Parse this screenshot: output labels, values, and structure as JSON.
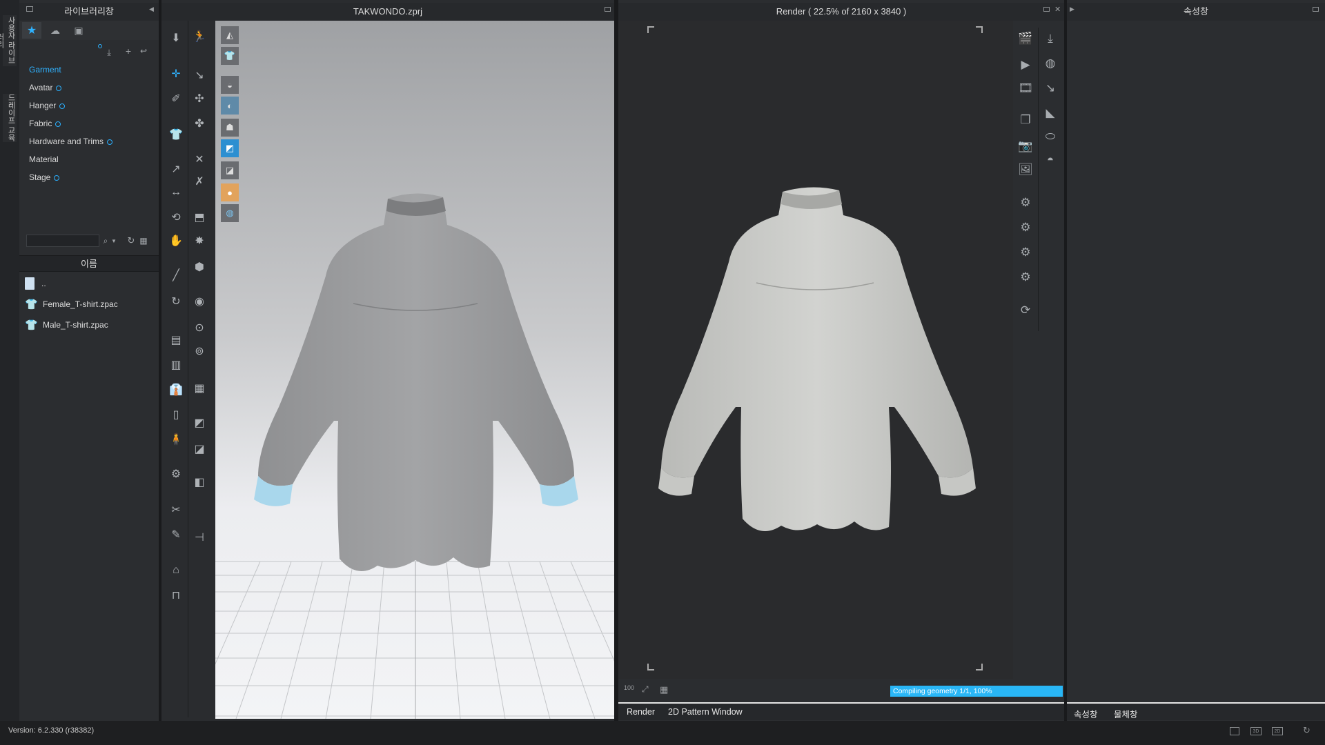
{
  "left_tabs": [
    "사용자 라이브러리",
    "드레이프 교육"
  ],
  "library": {
    "title": "라이브러리창",
    "categories": [
      {
        "label": "Garment",
        "badge": false,
        "active": true
      },
      {
        "label": "Avatar",
        "badge": true
      },
      {
        "label": "Hanger",
        "badge": true
      },
      {
        "label": "Fabric",
        "badge": true
      },
      {
        "label": "Hardware and Trims",
        "badge": true
      },
      {
        "label": "Material",
        "badge": false
      },
      {
        "label": "Stage",
        "badge": true
      }
    ],
    "search_placeholder": "",
    "name_header": "이름",
    "files": [
      {
        "name": "..",
        "icon": "folder-up-icon"
      },
      {
        "name": "Female_T-shirt.zpac",
        "icon": "tshirt-icon"
      },
      {
        "name": "Male_T-shirt.zpac",
        "icon": "tshirt-icon"
      }
    ]
  },
  "viewport3d": {
    "title": "TAKWONDO.zprj"
  },
  "render": {
    "title": "Render ( 22.5% of 2160 x 3840 )",
    "progress_text": "Compiling geometry 1/1, 100%",
    "progress": 1.0,
    "bottom_tabs": [
      "Render",
      "2D Pattern Window"
    ]
  },
  "property": {
    "title": "속성창",
    "bottom_tabs": [
      "속성창",
      "물체창"
    ]
  },
  "footer": {
    "version": "Version: 6.2.330 (r38382)"
  },
  "colors": {
    "accent": "#2fb2ff",
    "progress": "#29b6f6",
    "garment": "#9c9c9c",
    "cuff": "#a8d8ee"
  }
}
